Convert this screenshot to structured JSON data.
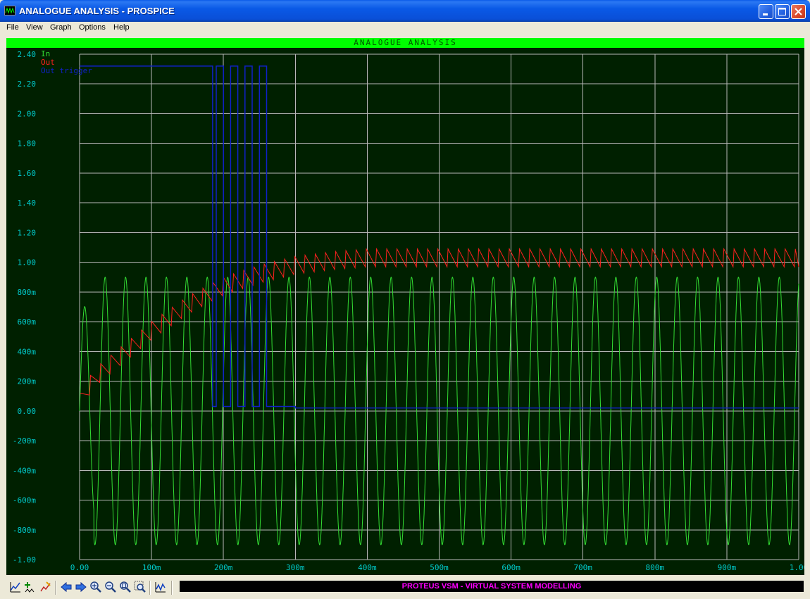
{
  "window": {
    "title": "ANALOGUE ANALYSIS - PROSPICE",
    "minimize_icon": "minimize-icon",
    "maximize_icon": "maximize-icon",
    "close_icon": "close-icon"
  },
  "menu": [
    "File",
    "View",
    "Graph",
    "Options",
    "Help"
  ],
  "graph": {
    "title": "ANALOGUE ANALYSIS",
    "background_color": "#002000",
    "grid_color": "#b8b8b8",
    "axis_text_color": "#00cccc"
  },
  "toolbar": {
    "icons": [
      "add-trace-icon",
      "add-marker-icon",
      "simulate-icon",
      "scroll-left-icon",
      "scroll-right-icon",
      "zoom-in-icon",
      "zoom-out-icon",
      "zoom-all-icon",
      "zoom-area-icon",
      "graph-icon"
    ]
  },
  "status": "PROTEUS VSM - VIRTUAL SYSTEM MODELLING",
  "chart_data": {
    "type": "line",
    "title": "ANALOGUE ANALYSIS",
    "xlabel": "",
    "ylabel": "",
    "xlim": [
      0,
      1.0
    ],
    "ylim": [
      -1.0,
      2.4
    ],
    "x_ticks": [
      "0.00",
      "100m",
      "200m",
      "300m",
      "400m",
      "500m",
      "600m",
      "700m",
      "800m",
      "900m",
      "1.00"
    ],
    "y_ticks": [
      "2.40",
      "2.20",
      "2.00",
      "1.80",
      "1.60",
      "1.40",
      "1.20",
      "1.00",
      "800m",
      "600m",
      "400m",
      "200m",
      "0.00",
      "-200m",
      "-400m",
      "-600m",
      "-800m",
      "-1.00"
    ],
    "grid": true,
    "legend_position": "top-left",
    "series": [
      {
        "name": "In",
        "color": "#33dd33",
        "description": "sine wave, frequency ~35 Hz, amplitude ~0.9 (first peak ~0.7), starting at 0"
      },
      {
        "name": "Out",
        "color": "#ff2020",
        "x": [
          0.0,
          0.02,
          0.05,
          0.1,
          0.15,
          0.2,
          0.25,
          0.3,
          0.35,
          0.4,
          0.5,
          0.6,
          0.7,
          0.8,
          0.9,
          1.0
        ],
        "y": [
          0.05,
          0.22,
          0.34,
          0.54,
          0.71,
          0.84,
          0.92,
          0.98,
          1.01,
          1.03,
          1.03,
          1.03,
          1.03,
          1.03,
          1.03,
          1.03
        ],
        "ripple_amplitude": 0.12
      },
      {
        "name": "Out trigger",
        "color": "#1020c8",
        "x": [
          0.0,
          0.18,
          0.185,
          0.19,
          0.2,
          0.21,
          0.22,
          0.23,
          0.24,
          0.25,
          0.26,
          0.3,
          1.0
        ],
        "y": [
          2.32,
          2.32,
          0.03,
          2.32,
          0.03,
          2.32,
          0.03,
          2.32,
          0.03,
          2.32,
          0.03,
          0.02,
          0.02
        ]
      }
    ]
  }
}
